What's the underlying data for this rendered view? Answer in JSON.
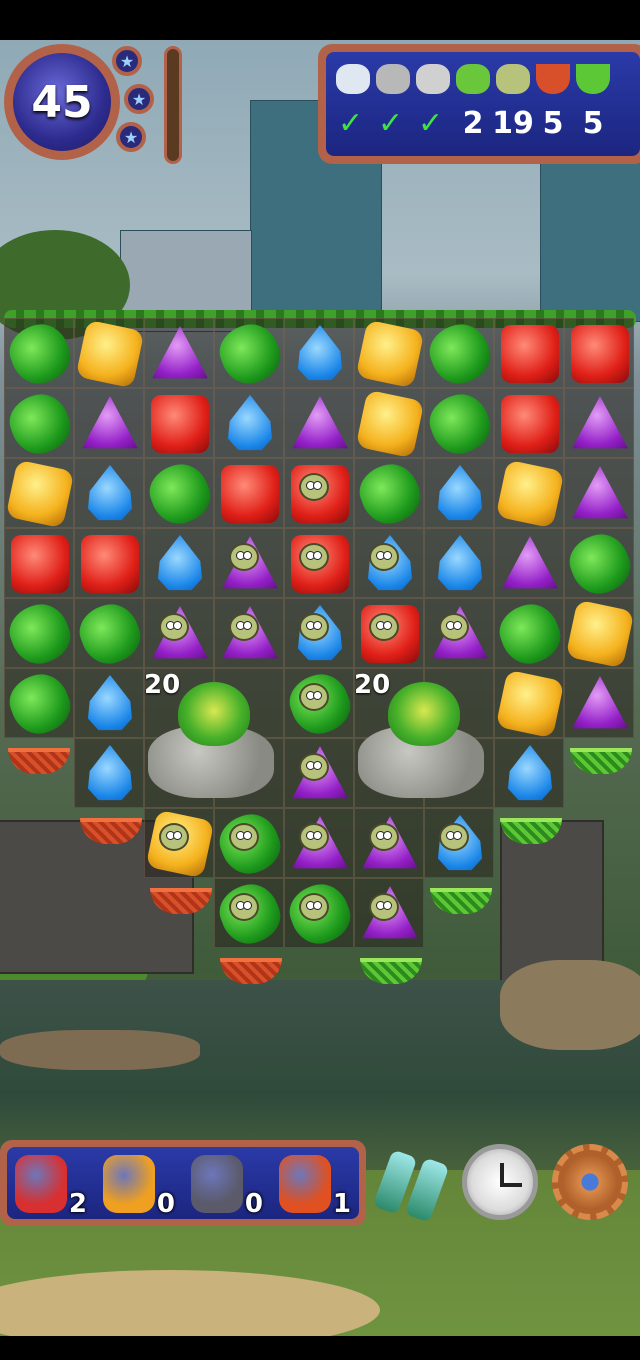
{
  "level": {
    "number": "45",
    "stars": [
      "★",
      "★",
      "★"
    ]
  },
  "goals": [
    {
      "icon": "sparkle-dust-icon",
      "done": true,
      "check": "✓"
    },
    {
      "icon": "broken-stones-icon",
      "done": true,
      "check": "✓"
    },
    {
      "icon": "stone-icon",
      "done": true,
      "check": "✓"
    },
    {
      "icon": "frog-on-rock-icon",
      "done": false,
      "value": "2"
    },
    {
      "icon": "monster-icon",
      "done": false,
      "value": "19"
    },
    {
      "icon": "red-basket-icon",
      "done": false,
      "value": "5"
    },
    {
      "icon": "green-basket-icon",
      "done": false,
      "value": "5"
    }
  ],
  "frogs": [
    {
      "counter": "20"
    },
    {
      "counter": "20"
    }
  ],
  "boosters": [
    {
      "icon": "magnet-icon",
      "count": "2"
    },
    {
      "icon": "rocket-horizontal-icon",
      "count": "0"
    },
    {
      "icon": "hammer-icon",
      "count": "0"
    },
    {
      "icon": "rocket-vertical-icon",
      "count": "1"
    }
  ],
  "tools": [
    {
      "icon": "binoculars-icon"
    },
    {
      "icon": "clock-icon"
    },
    {
      "icon": "settings-gear-icon"
    }
  ],
  "board_rows": [
    [
      "green",
      "yellow",
      "purple",
      "green",
      "blue",
      "yellow",
      "green",
      "red",
      "red"
    ],
    [
      "green",
      "purple",
      "red",
      "blue",
      "purple",
      "yellow",
      "green",
      "red",
      "purple"
    ],
    [
      "yellow",
      "blue",
      "green",
      "red",
      "red-m",
      "green",
      "blue",
      "yellow",
      "purple"
    ],
    [
      "red",
      "red",
      "blue",
      "purple-m",
      "red-m",
      "blue-m",
      "blue",
      "purple",
      "green"
    ],
    [
      "green",
      "green",
      "purple-m",
      "purple-m",
      "blue-m",
      "red-m",
      "purple-m",
      "green",
      "yellow"
    ],
    [
      "green",
      "blue",
      "frog",
      "",
      "green-m",
      "frog",
      "",
      "yellow",
      "purple"
    ],
    [
      "",
      "blue",
      "",
      "",
      "purple-m",
      "",
      "",
      "blue",
      ""
    ],
    [
      "",
      "",
      "yellow-m",
      "green-m",
      "purple-m",
      "purple-m",
      "blue-m",
      "",
      ""
    ],
    [
      "",
      "",
      "",
      "green-m",
      "green-m",
      "purple-m",
      "",
      "",
      ""
    ]
  ],
  "colors": {
    "frame": "#b3624a",
    "panel": "#1c2680",
    "check": "#3fe048"
  }
}
